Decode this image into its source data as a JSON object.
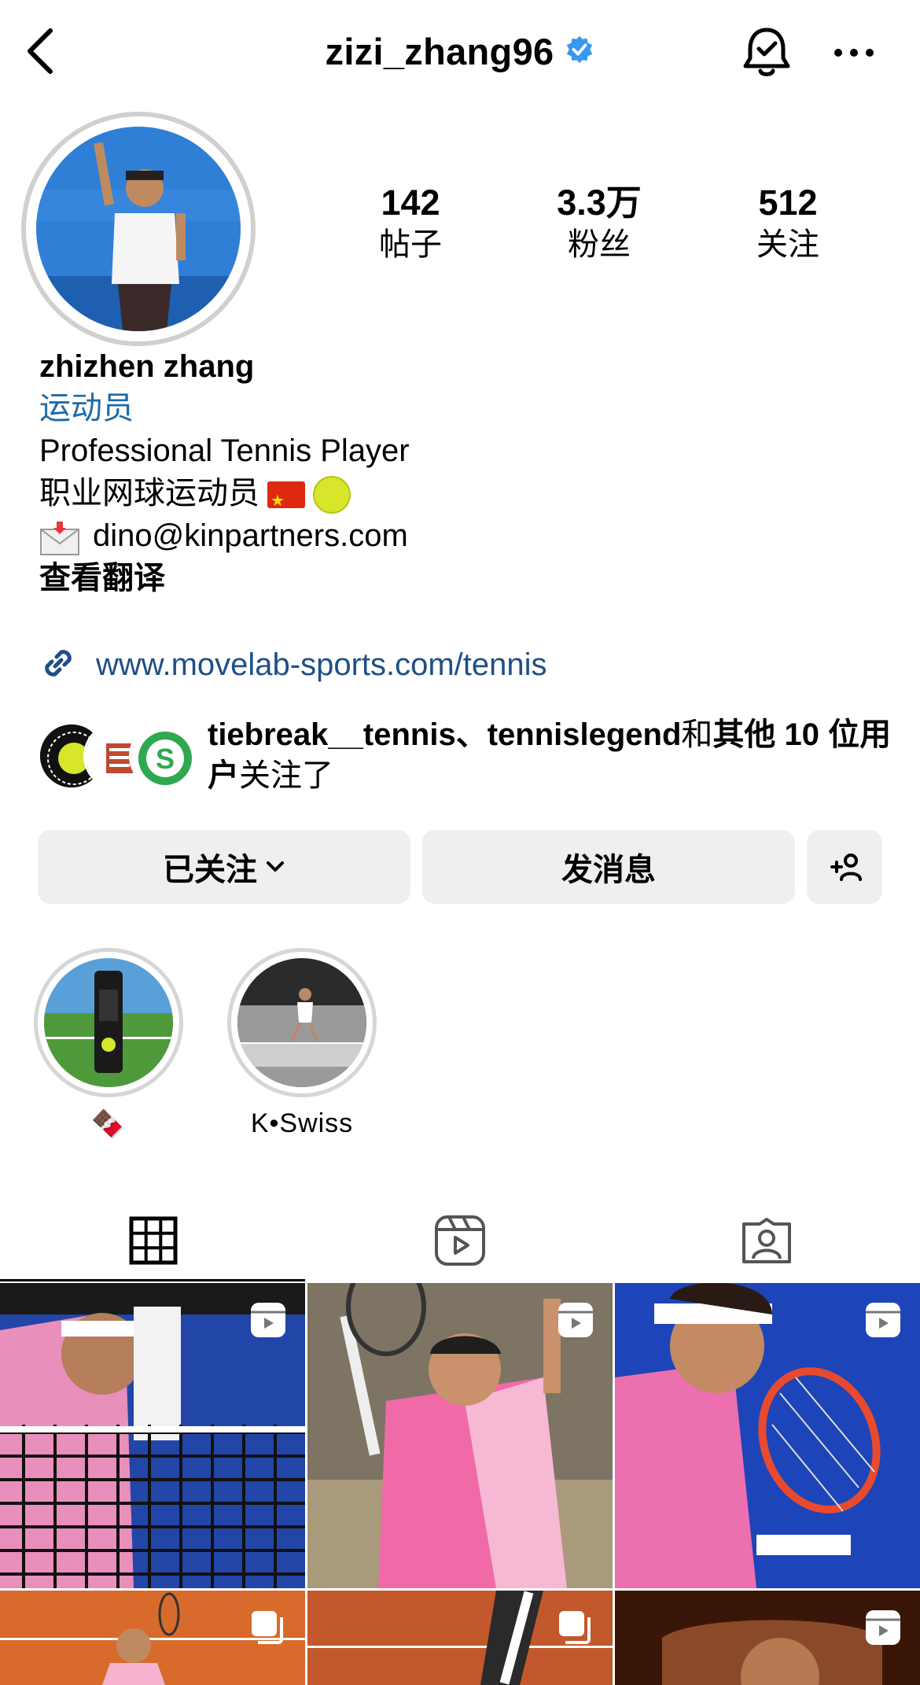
{
  "header": {
    "username": "zizi_zhang96",
    "verified": true
  },
  "profile": {
    "stats": [
      {
        "value": "142",
        "label": "帖子"
      },
      {
        "value": "3.3万",
        "label": "粉丝"
      },
      {
        "value": "512",
        "label": "关注"
      }
    ],
    "name": "zhizhen zhang",
    "category": "运动员",
    "bio_line1": "Professional Tennis Player",
    "bio_line2": "职业网球运动员",
    "email": "dino@kinpartners.com",
    "translate": "查看翻译",
    "link": "www.movelab-sports.com/tennis"
  },
  "followed_by": {
    "names": "tiebreak__tennis、tennislegend",
    "middle": "和",
    "others": "其他 10 位用户",
    "suffix": "关注了"
  },
  "actions": {
    "following_label": "已关注",
    "message_label": "发消息"
  },
  "highlights": [
    {
      "label": "🍫"
    },
    {
      "label": "K•Swiss"
    }
  ],
  "tabs": [
    "grid-icon",
    "reels-icon",
    "tagged-icon"
  ],
  "colors": {
    "link": "#1f4f85",
    "category": "#1f6aa5",
    "verified": "#3897f0",
    "button_bg": "#efefef"
  }
}
